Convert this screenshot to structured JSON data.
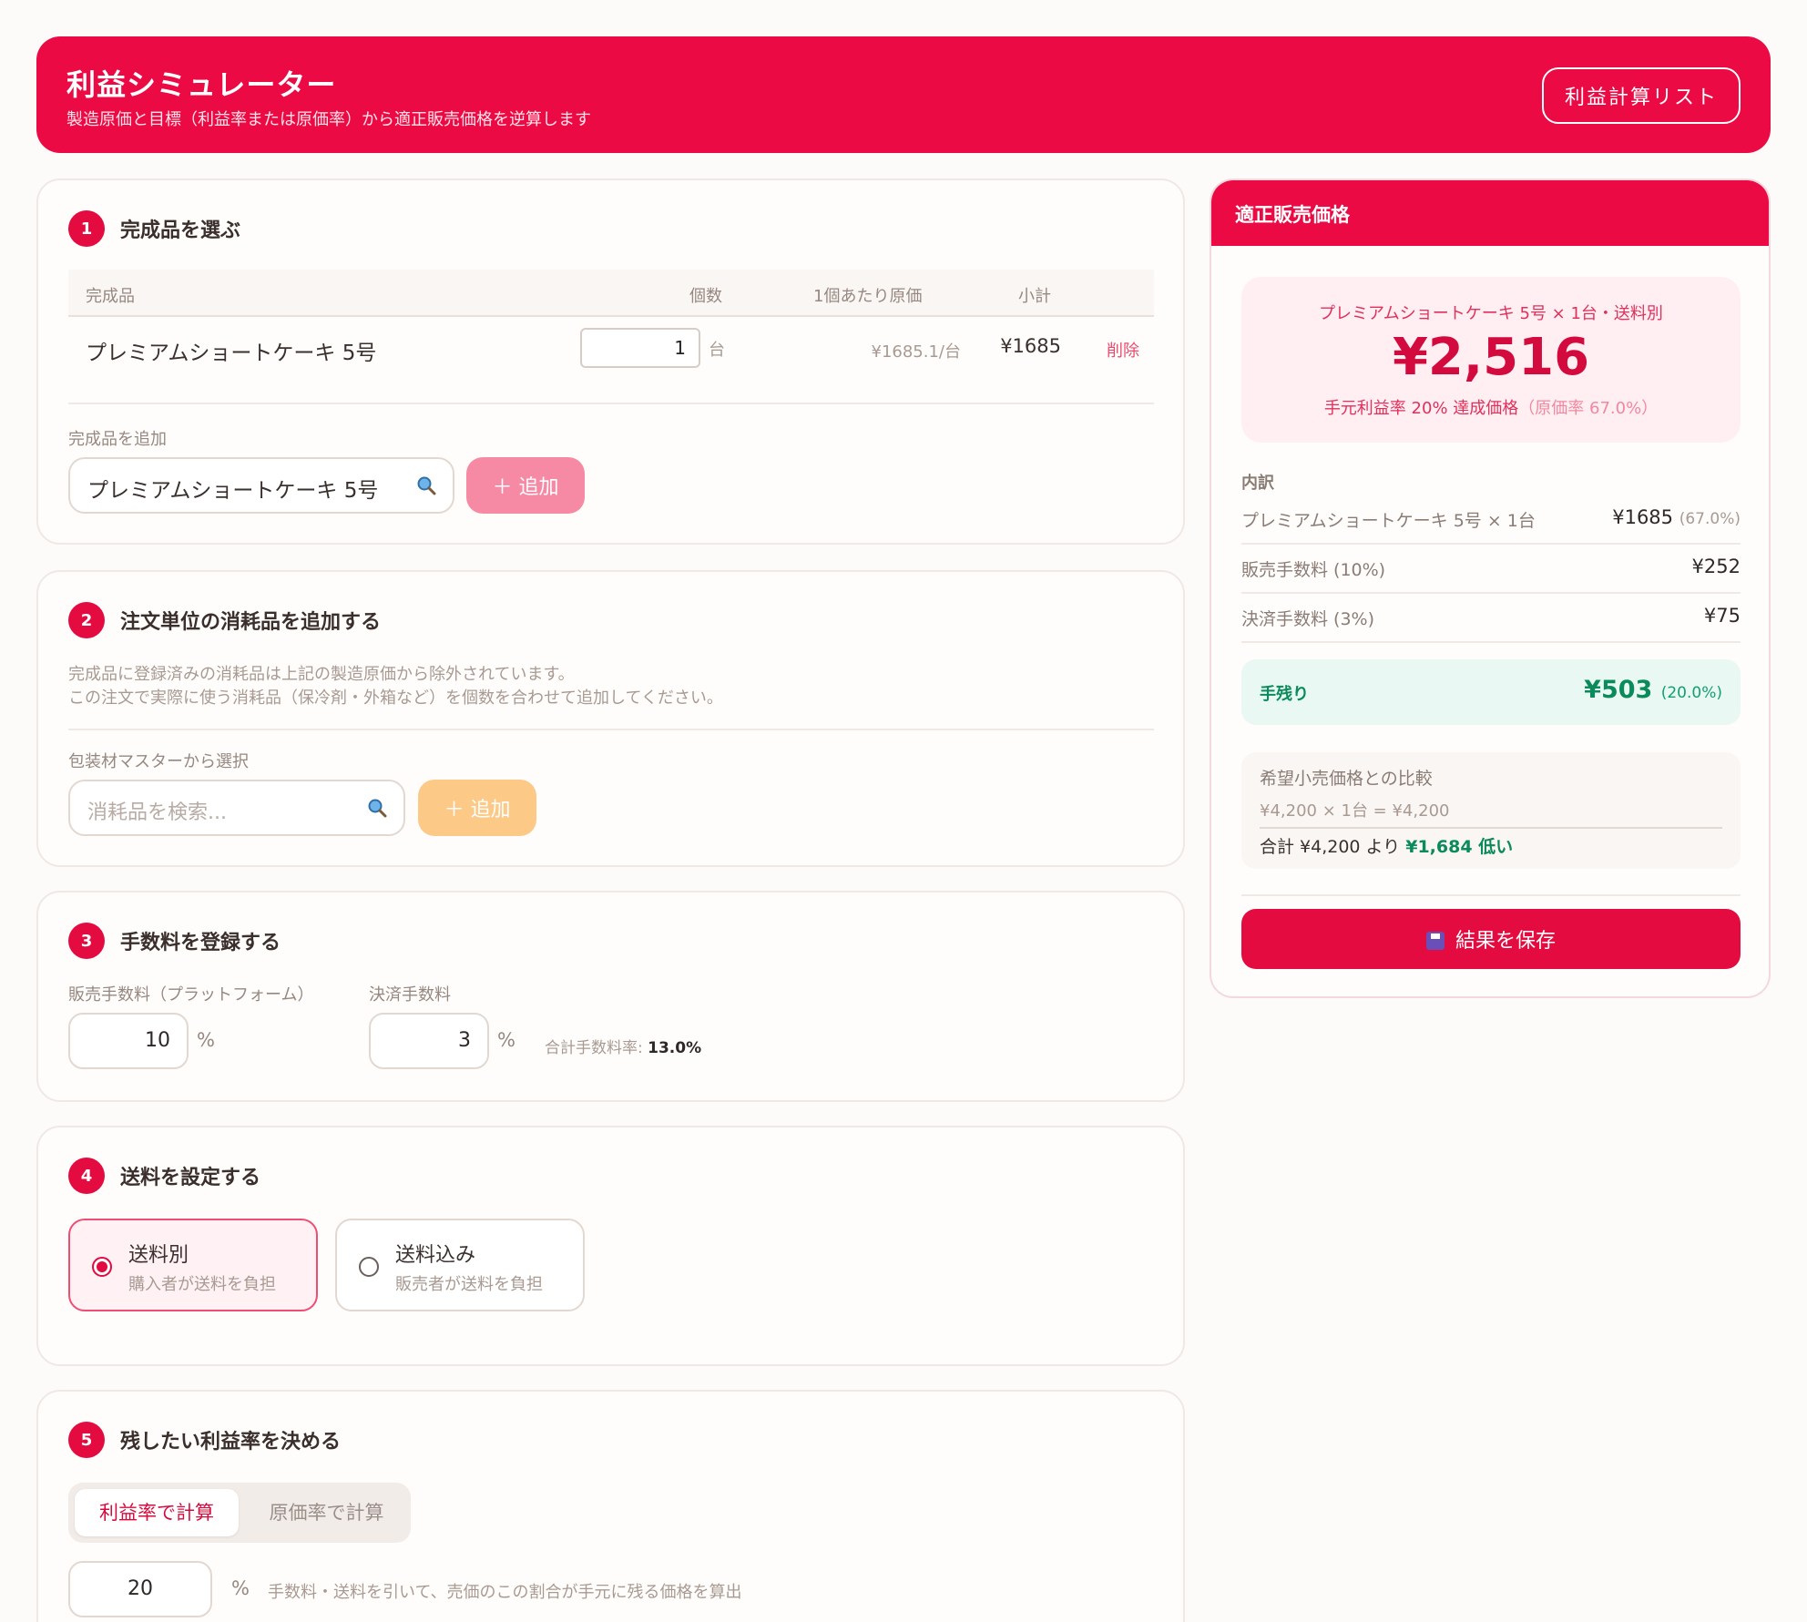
{
  "header": {
    "title": "利益シミュレーター",
    "subtitle": "製造原価と目標（利益率または原価率）から適正販売価格を逆算します",
    "list_button": "利益計算リスト"
  },
  "step1": {
    "num": "1",
    "title": "完成品を選ぶ",
    "columns": {
      "product": "完成品",
      "qty": "個数",
      "unit_cost": "1個あたり原価",
      "subtotal": "小計"
    },
    "row": {
      "name": "プレミアムショートケーキ 5号",
      "qty": "1",
      "unit": "台",
      "unit_cost": "¥1685.1/台",
      "subtotal": "¥1685",
      "delete": "削除"
    },
    "add_label": "完成品を追加",
    "search_value": "プレミアムショートケーキ 5号",
    "add_button": "＋ 追加"
  },
  "step2": {
    "num": "2",
    "title": "注文単位の消耗品を追加する",
    "desc1": "完成品に登録済みの消耗品は上記の製造原価から除外されています。",
    "desc2": "この注文で実際に使う消耗品（保冷剤・外箱など）を個数を合わせて追加してください。",
    "select_label": "包装材マスターから選択",
    "search_placeholder": "消耗品を検索...",
    "add_button": "＋ 追加"
  },
  "step3": {
    "num": "3",
    "title": "手数料を登録する",
    "sales_fee_label": "販売手数料（プラットフォーム）",
    "sales_fee": "10",
    "payment_fee_label": "決済手数料",
    "payment_fee": "3",
    "pct": "%",
    "total_label": "合計手数料率:",
    "total_value": "13.0%"
  },
  "step4": {
    "num": "4",
    "title": "送料を設定する",
    "options": [
      {
        "title": "送料別",
        "sub": "購入者が送料を負担",
        "selected": true
      },
      {
        "title": "送料込み",
        "sub": "販売者が送料を負担",
        "selected": false
      }
    ]
  },
  "step5": {
    "num": "5",
    "title": "残したい利益率を決める",
    "tab_active": "利益率で計算",
    "tab_inactive": "原価率で計算",
    "value": "20",
    "pct": "%",
    "hint": "手数料・送料を引いて、売価のこの割合が手元に残る価格を算出"
  },
  "result": {
    "header": "適正販売価格",
    "caption": "プレミアムショートケーキ 5号 × 1台・送料別",
    "price": "¥2,516",
    "note_main": "手元利益率 20% 達成価格",
    "note_sub": "（原価率 67.0%）",
    "breakdown_label": "内訳",
    "rows": [
      {
        "k": "プレミアムショートケーキ 5号 × 1台",
        "v": "¥1685",
        "pct": "(67.0%)"
      },
      {
        "k": "販売手数料 (10%)",
        "v": "¥252",
        "pct": ""
      },
      {
        "k": "決済手数料 (3%)",
        "v": "¥75",
        "pct": ""
      }
    ],
    "remain_label": "手残り",
    "remain_value": "¥503",
    "remain_pct": "(20.0%)",
    "compare_title": "希望小売価格との比較",
    "compare_calc": "¥4,200 × 1台 = ¥4,200",
    "compare_sum_pre": "合計 ¥4,200 より",
    "compare_sum_diff": "¥1,684 低い",
    "save_button": "結果を保存"
  },
  "colors": {
    "brand": "#eb0a43",
    "accent_green": "#0b8a5b",
    "add_pink": "#f68aa4",
    "add_orange": "#fdc987"
  }
}
